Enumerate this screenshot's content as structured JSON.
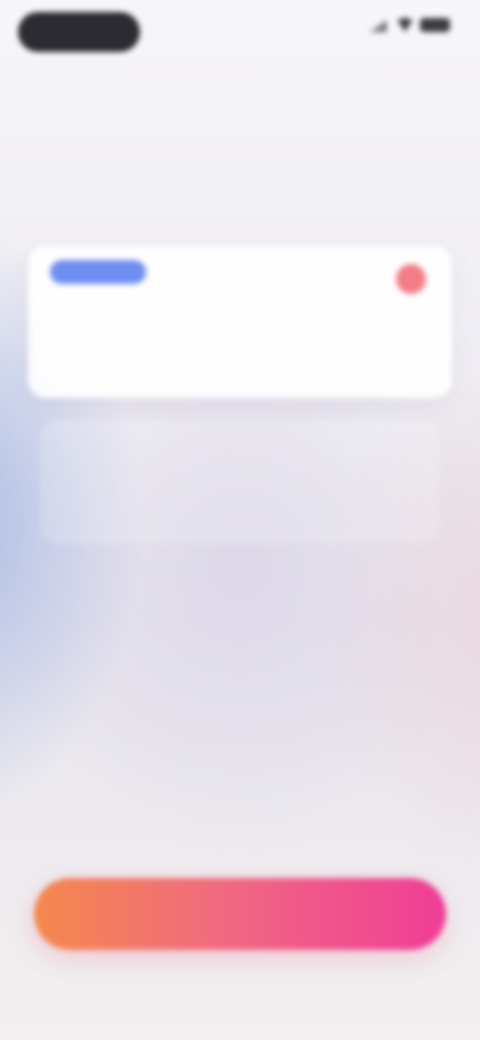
{
  "status_bar": {
    "time": "",
    "icons": [
      "signal-icon",
      "wifi-icon",
      "battery-icon"
    ]
  },
  "title": "",
  "plans": [
    {
      "badge": "",
      "name": "",
      "note": "",
      "price": "",
      "selected": true
    },
    {
      "name": "",
      "note": "",
      "price": "",
      "selected": false
    }
  ],
  "footnote": "",
  "cta": {
    "label": ""
  },
  "legal": "",
  "colors": {
    "badge": "#6e8ef2",
    "selected_dot": "#f27d86",
    "cta_start": "#f5884c",
    "cta_mid": "#f06a7f",
    "cta_end": "#f03d98"
  }
}
